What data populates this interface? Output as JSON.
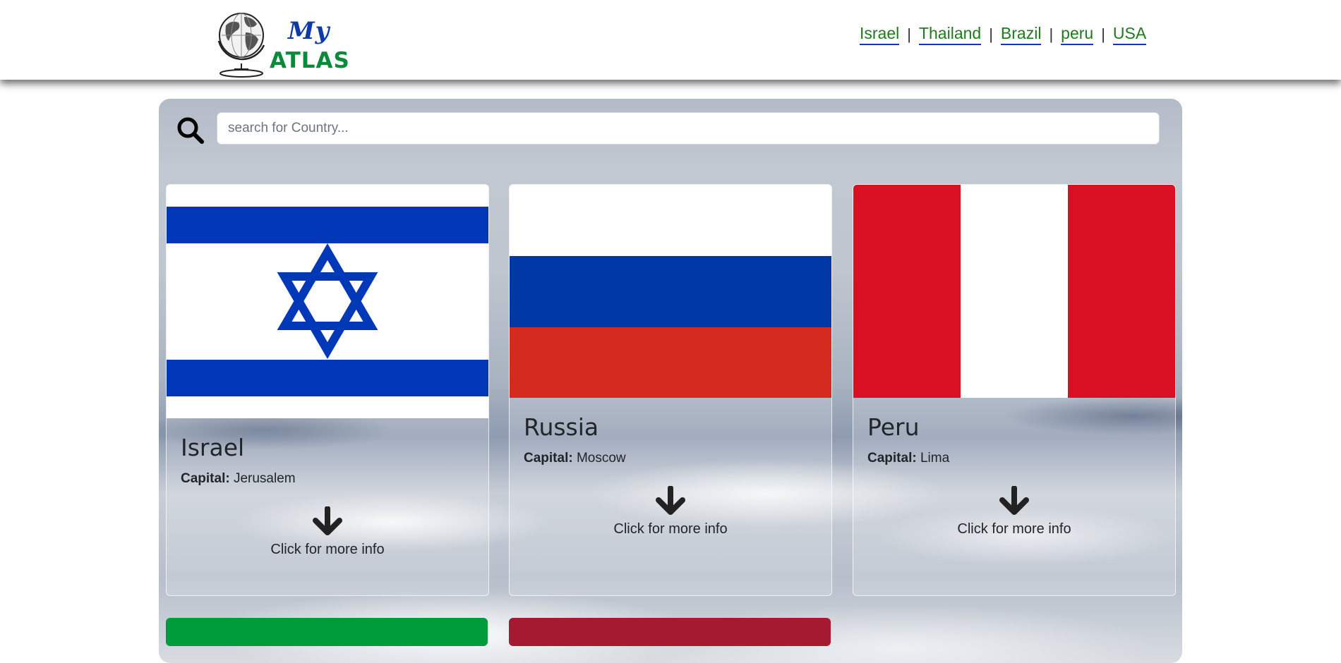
{
  "header": {
    "logo": {
      "line1": "My",
      "line2": "ATLAS"
    },
    "nav_links": [
      "Israel",
      "Thailand",
      "Brazil",
      "peru",
      "USA"
    ],
    "nav_separator": "|"
  },
  "search": {
    "placeholder": "search for Country...",
    "value": ""
  },
  "cards": [
    {
      "name": "Israel",
      "capital_label": "Capital:",
      "capital": "Jerusalem",
      "more_info": "Click for more info"
    },
    {
      "name": "Russia",
      "capital_label": "Capital:",
      "capital": "Moscow",
      "more_info": "Click for more info"
    },
    {
      "name": "Peru",
      "capital_label": "Capital:",
      "capital": "Lima",
      "more_info": "Click for more info"
    }
  ],
  "colors": {
    "nav_link": "#1f7a1f",
    "nav_underline": "#1633c9",
    "logo_my": "#0d3aa8",
    "logo_atlas": "#0a8a3a",
    "israel_blue": "#0038b8",
    "russia_blue": "#0039a6",
    "russia_red": "#d52b1e",
    "peru_red": "#d91023",
    "next_flag_green": "#009b3a",
    "next_flag_red": "#a51931"
  }
}
